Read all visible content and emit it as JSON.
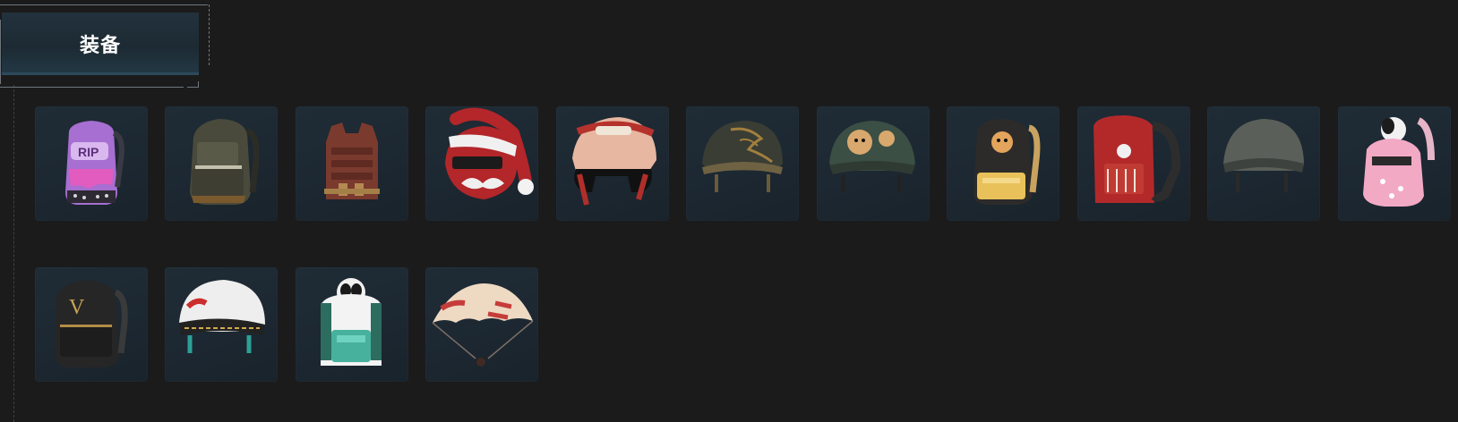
{
  "header": {
    "title": "装备"
  },
  "items_row1": [
    {
      "icon": "graffiti-backpack-icon"
    },
    {
      "icon": "military-backpack-icon"
    },
    {
      "icon": "brown-vest-icon"
    },
    {
      "icon": "santa-helmet-icon"
    },
    {
      "icon": "racing-helmet-icon"
    },
    {
      "icon": "dragon-helmet-icon"
    },
    {
      "icon": "corgi-helmet-icon"
    },
    {
      "icon": "shiba-backpack-icon"
    },
    {
      "icon": "red-backpack-icon"
    },
    {
      "icon": "gray-helmet-icon"
    },
    {
      "icon": "pink-puppy-backpack-icon"
    }
  ],
  "items_row2": [
    {
      "icon": "black-gold-backpack-icon"
    },
    {
      "icon": "white-pattern-helmet-icon"
    },
    {
      "icon": "panda-backpack-icon"
    },
    {
      "icon": "parachute-icon"
    }
  ],
  "colors": {
    "background": "#1b1b1c",
    "card": "#1e2a34",
    "header_tab": "#22323d",
    "frame": "#6f767c"
  }
}
